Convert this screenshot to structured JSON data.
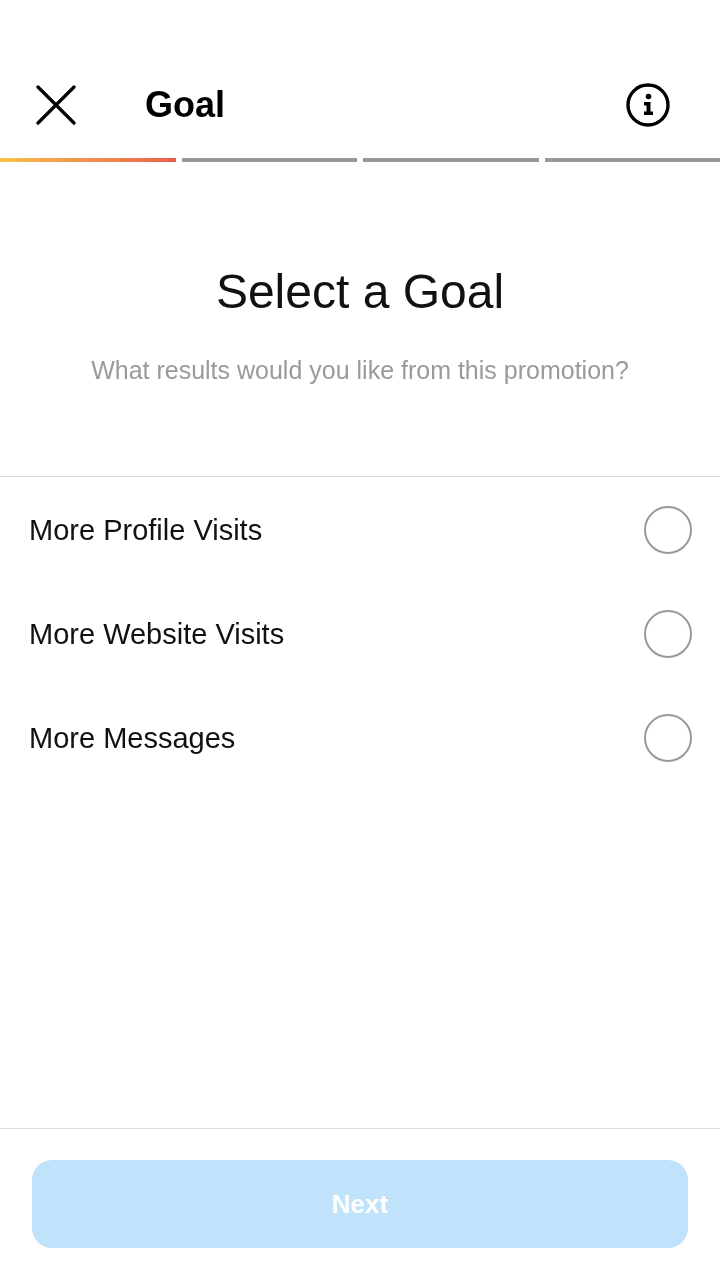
{
  "header": {
    "title": "Goal"
  },
  "progress": [
    {
      "completed": true
    },
    {
      "completed": false
    },
    {
      "completed": false
    },
    {
      "completed": false
    }
  ],
  "heading": "Select a Goal",
  "subheading": "What results would you like from this promotion?",
  "options": [
    {
      "label": "More Profile Visits",
      "selected": false
    },
    {
      "label": "More Website Visits",
      "selected": false
    },
    {
      "label": "More Messages",
      "selected": false
    }
  ],
  "next_button": {
    "label": "Next",
    "disabled": true
  }
}
